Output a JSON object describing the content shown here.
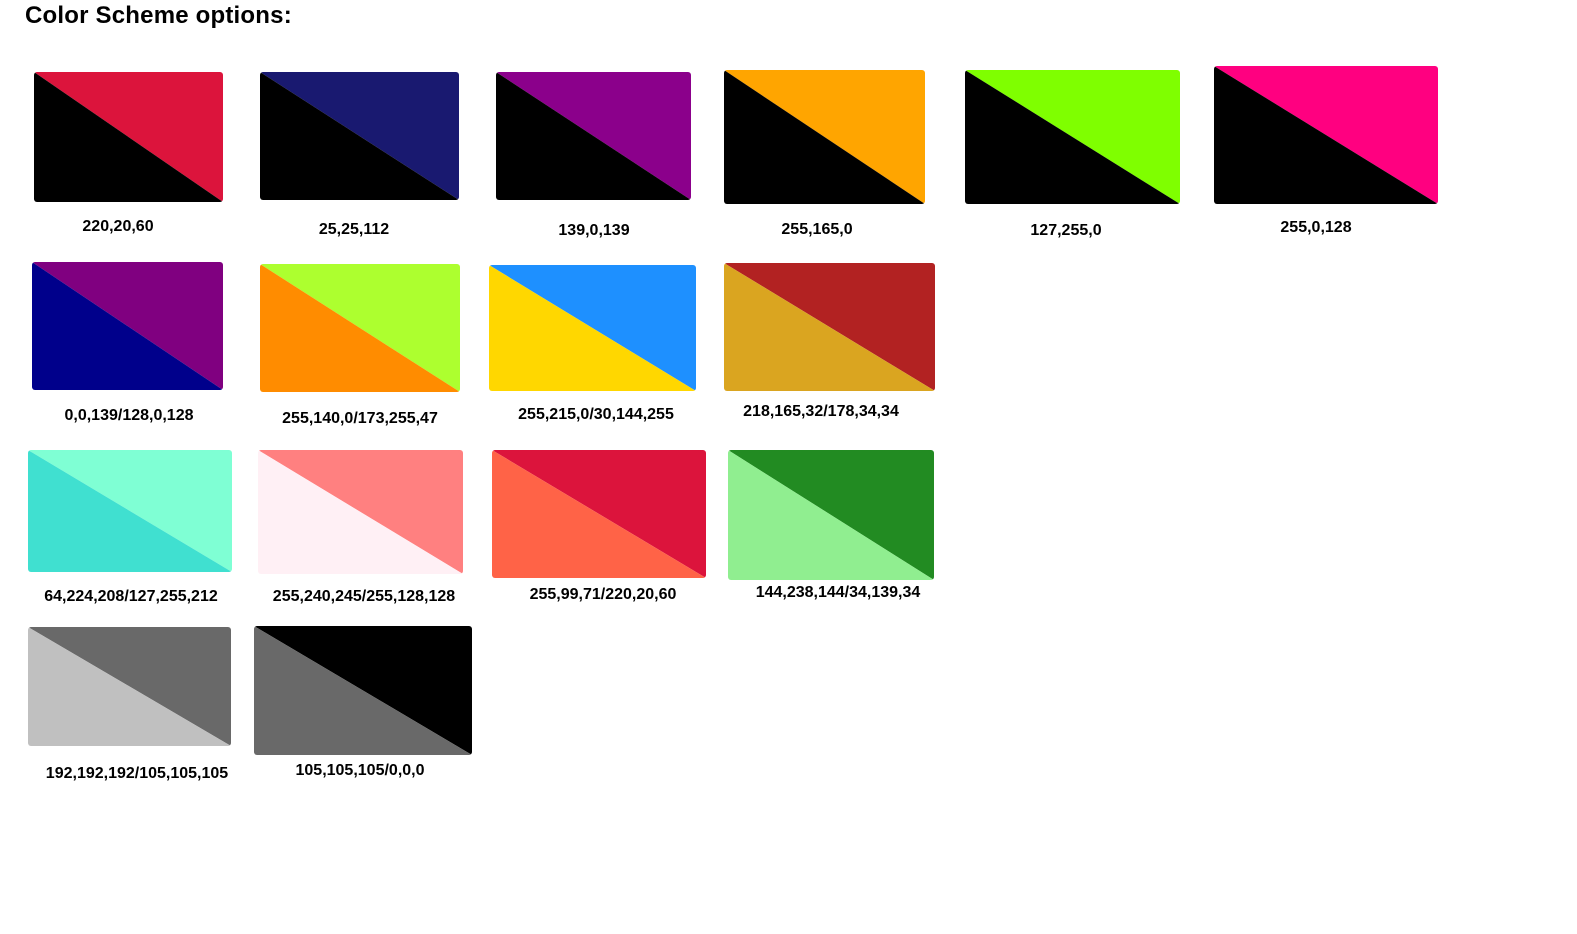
{
  "title": "Color Scheme options:",
  "options": [
    {
      "label": "220,20,60",
      "primary": "#000000",
      "secondary": "#dc143c"
    },
    {
      "label": "25,25,112",
      "primary": "#000000",
      "secondary": "#191970"
    },
    {
      "label": "139,0,139",
      "primary": "#000000",
      "secondary": "#8b008b"
    },
    {
      "label": "255,165,0",
      "primary": "#000000",
      "secondary": "#ffa500"
    },
    {
      "label": "127,255,0",
      "primary": "#000000",
      "secondary": "#7fff00"
    },
    {
      "label": "255,0,128",
      "primary": "#000000",
      "secondary": "#ff0080"
    },
    {
      "label": "0,0,139/128,0,128",
      "primary": "#00008b",
      "secondary": "#800080"
    },
    {
      "label": "255,140,0/173,255,47",
      "primary": "#ff8c00",
      "secondary": "#adff2f"
    },
    {
      "label": "255,215,0/30,144,255",
      "primary": "#ffd700",
      "secondary": "#1e90ff"
    },
    {
      "label": "218,165,32/178,34,34",
      "primary": "#daa520",
      "secondary": "#b22222"
    },
    {
      "label": "64,224,208/127,255,212",
      "primary": "#40e0d0",
      "secondary": "#7fffd4"
    },
    {
      "label": "255,240,245/255,128,128",
      "primary": "#fff0f5",
      "secondary": "#ff8080"
    },
    {
      "label": "255,99,71/220,20,60",
      "primary": "#ff6347",
      "secondary": "#dc143c"
    },
    {
      "label": "144,238,144/34,139,34",
      "primary": "#90ee90",
      "secondary": "#228b22"
    },
    {
      "label": "192,192,192/105,105,105",
      "primary": "#c0c0c0",
      "secondary": "#696969"
    },
    {
      "label": "105,105,105/0,0,0",
      "primary": "#696969",
      "secondary": "#000000"
    }
  ]
}
